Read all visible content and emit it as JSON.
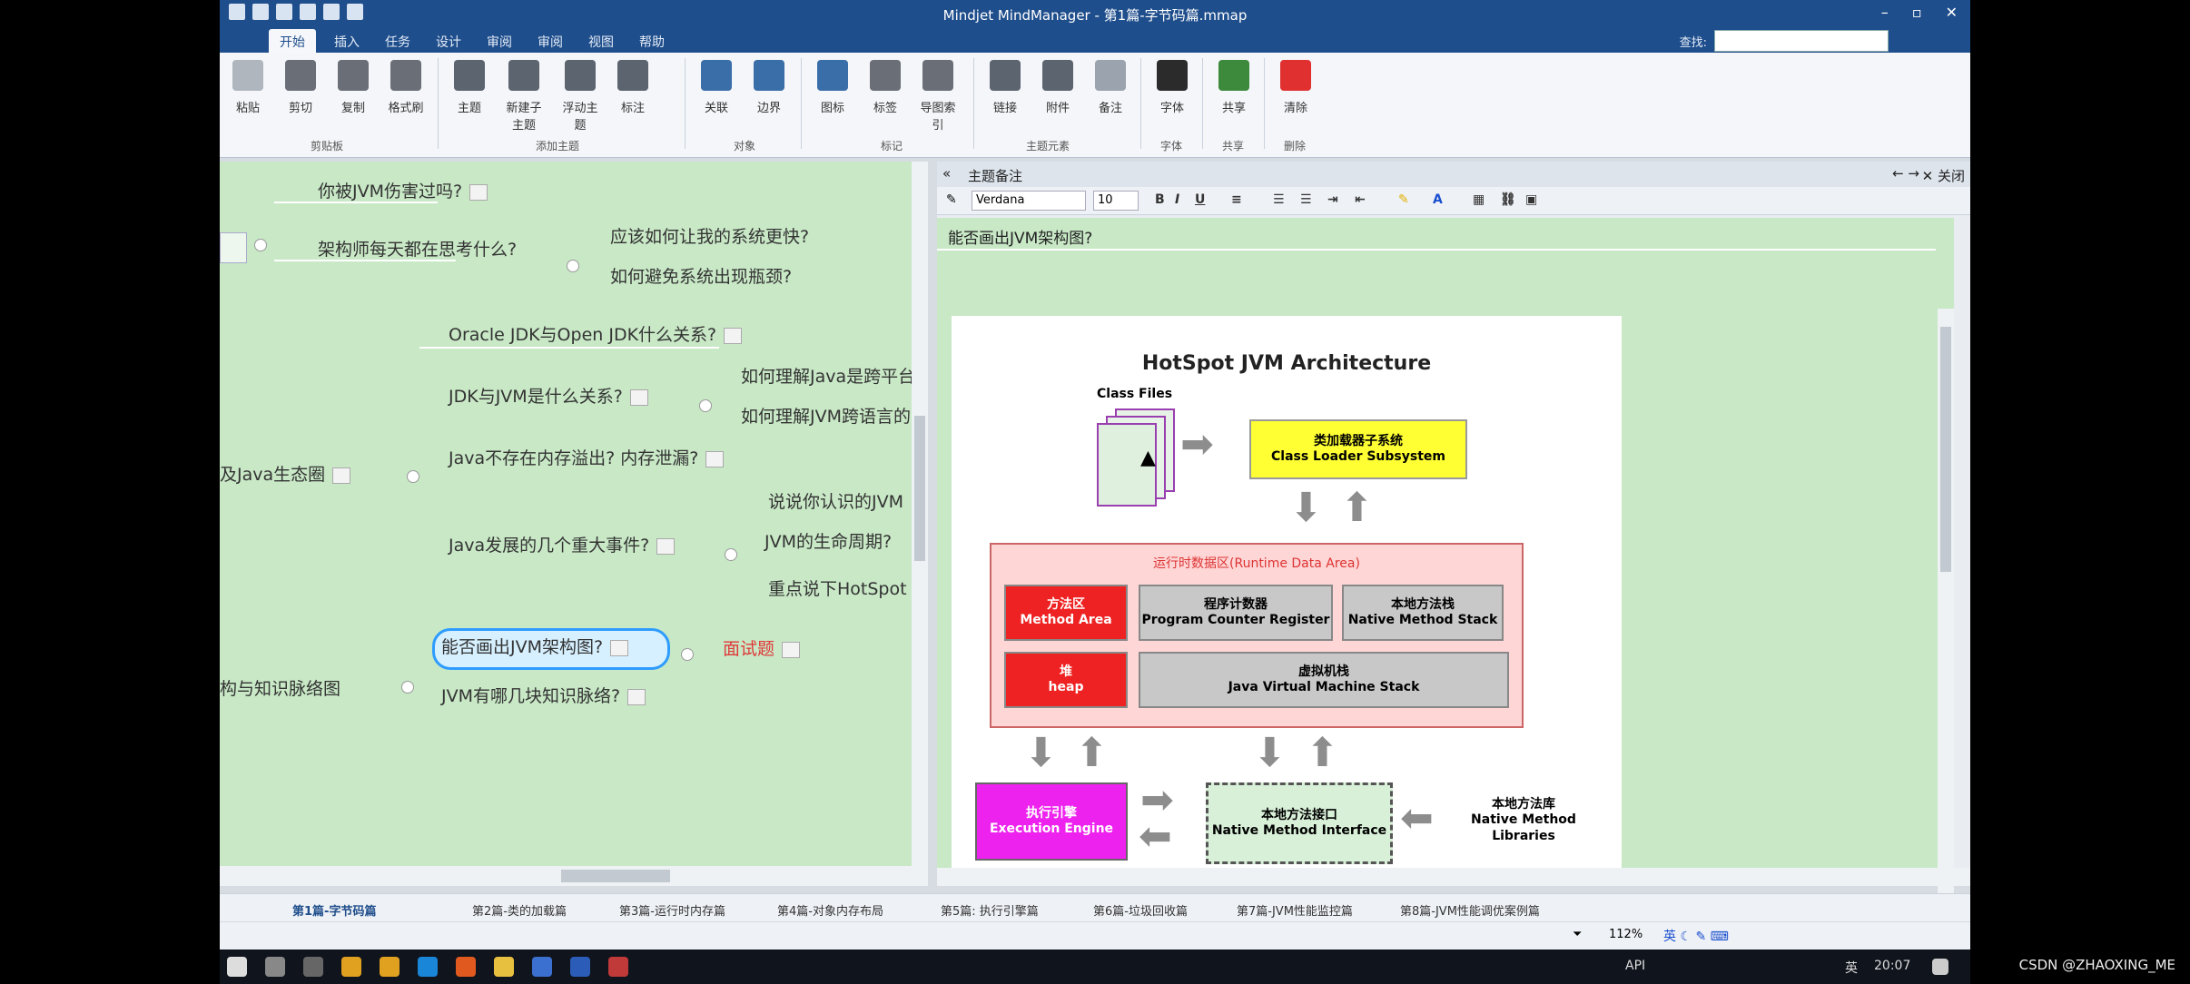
{
  "window": {
    "title": "Mindjet MindManager - 第1篇-字节码篇.mmap"
  },
  "ribbon": {
    "tabs": [
      "开始",
      "插入",
      "任务",
      "设计",
      "审阅",
      "审阅",
      "视图",
      "帮助"
    ],
    "search_label": "查找:",
    "buttons": {
      "paste": "粘贴",
      "cut": "剪切",
      "copy": "复制",
      "format_painter": "格式刷",
      "topic": "主题",
      "new_subtopic": "新建子主题",
      "floating_topic": "浮动主题",
      "callout": "标注",
      "relation": "关联",
      "boundary": "边界",
      "icon": "图标",
      "tag": "标签",
      "map_index": "导图索引",
      "link": "链接",
      "attachment": "附件",
      "note": "备注",
      "font": "字体",
      "share": "共享",
      "delete": "清除"
    },
    "groups": {
      "clipboard": "剪贴板",
      "add_topic": "添加主题",
      "object": "对象",
      "mark": "标记",
      "topic_elements": "主题元素",
      "font": "字体",
      "share": "共享",
      "delete": "删除"
    }
  },
  "map": {
    "nodes": {
      "n1": "你被JVM伤害过吗?",
      "n2": "架构师每天都在思考什么?",
      "n3": "应该如何让我的系统更快?",
      "n4": "如何避免系统出现瓶颈?",
      "n5": "Oracle JDK与Open JDK什么关系?",
      "n6": "JDK与JVM是什么关系?",
      "n7": "如何理解Java是跨平台",
      "n8": "如何理解JVM跨语言的",
      "n9": "Java不存在内存溢出? 内存泄漏?",
      "n10": "说说你认识的JVM",
      "n11": "及Java生态圈",
      "n12": "JVM的生命周期?",
      "n13": "Java发展的几个重大事件?",
      "n14": "重点说下HotSpot",
      "n15": "能否画出JVM架构图?",
      "n16": "面试题",
      "n17": "构与知识脉络图",
      "n18": "JVM有哪几块知识脉络?"
    }
  },
  "notes": {
    "header": "主题备注",
    "close_label": "关闭",
    "font": "Verdana",
    "size": "10",
    "topic_title": "能否画出JVM架构图?"
  },
  "diagram": {
    "title": "HotSpot JVM Architecture",
    "class_files": "Class Files",
    "class_loader_cn": "类加载器子系统",
    "class_loader_en": "Class Loader Subsystem",
    "runtime_area": "运行时数据区(Runtime Data Area)",
    "method_area_cn": "方法区",
    "method_area_en": "Method Area",
    "pc_cn": "程序计数器",
    "pc_en": "Program Counter Register",
    "native_stack_cn": "本地方法栈",
    "native_stack_en": "Native Method Stack",
    "heap_cn": "堆",
    "heap_en": "heap",
    "vm_stack_cn": "虚拟机栈",
    "vm_stack_en": "Java Virtual Machine Stack",
    "exec_cn": "执行引擎",
    "exec_en": "Execution Engine",
    "nmi_cn": "本地方法接口",
    "nmi_en": "Native Method Interface",
    "nml_cn": "本地方法库",
    "nml_en1": "Native Method",
    "nml_en2": "Libraries",
    "colors": {
      "yellow": "#ffff33",
      "red": "#ee2222",
      "gray": "#c8c8c8",
      "magenta": "#ee22ee",
      "pink": "#ffd6d6",
      "mint": "#d8f0d8"
    }
  },
  "doc_tabs": [
    "第1篇-字节码篇",
    "第2篇-类的加载篇",
    "第3篇-运行时内存篇",
    "第4篇-对象内存布局",
    "第5篇: 执行引擎篇",
    "第6篇-垃圾回收篇",
    "第7篇-JVM性能监控篇",
    "第8篇-JVM性能调优案例篇"
  ],
  "status": {
    "zoom": "112%"
  },
  "taskbar": {
    "time": "20:07",
    "lang": "英",
    "api": "API"
  },
  "watermark": "CSDN @ZHAOXING_ME"
}
